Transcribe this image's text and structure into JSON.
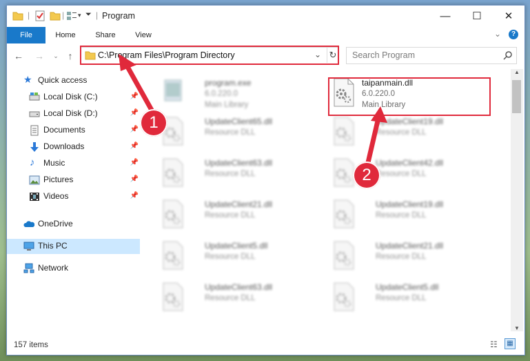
{
  "window": {
    "title": "Program",
    "caption": {
      "minimize": "—",
      "maximize": "☐",
      "close": "✕"
    }
  },
  "ribbon": {
    "tabs": [
      "File",
      "Home",
      "Share",
      "View"
    ]
  },
  "address": {
    "path": "C:\\Program Files\\Program Directory"
  },
  "search": {
    "placeholder": "Search Program"
  },
  "sidebar": {
    "items": [
      {
        "label": "Quick access",
        "icon": "star-icon",
        "pinned": false
      },
      {
        "label": "Local Disk (C:)",
        "icon": "drive-icon",
        "pinned": true
      },
      {
        "label": "Local Disk (D:)",
        "icon": "drive-icon",
        "pinned": true
      },
      {
        "label": "Documents",
        "icon": "documents-icon",
        "pinned": true
      },
      {
        "label": "Downloads",
        "icon": "download-icon",
        "pinned": true
      },
      {
        "label": "Music",
        "icon": "music-icon",
        "pinned": true
      },
      {
        "label": "Pictures",
        "icon": "pictures-icon",
        "pinned": true
      },
      {
        "label": "Videos",
        "icon": "videos-icon",
        "pinned": true
      },
      {
        "label": "OneDrive",
        "icon": "cloud-icon",
        "pinned": false
      },
      {
        "label": "This PC",
        "icon": "computer-icon",
        "pinned": false
      },
      {
        "label": "Network",
        "icon": "network-icon",
        "pinned": false
      }
    ]
  },
  "files": [
    {
      "name": "program.exe",
      "line2": "6.0.220.0",
      "line3": "Main Library",
      "highlight": false
    },
    {
      "name": "taipanmain.dll",
      "line2": "6.0.220.0",
      "line3": "Main Library",
      "highlight": true
    },
    {
      "name": "UpdateClient65.dll",
      "line2": "Resource DLL",
      "line3": "",
      "highlight": false
    },
    {
      "name": "UpdateClient19.dll",
      "line2": "Resource DLL",
      "line3": "",
      "highlight": false
    },
    {
      "name": "UpdateClient63.dll",
      "line2": "Resource DLL",
      "line3": "",
      "highlight": false
    },
    {
      "name": "UpdateClient42.dll",
      "line2": "Resource DLL",
      "line3": "",
      "highlight": false
    },
    {
      "name": "UpdateClient21.dll",
      "line2": "Resource DLL",
      "line3": "",
      "highlight": false
    },
    {
      "name": "UpdateClient19.dll",
      "line2": "Resource DLL",
      "line3": "",
      "highlight": false
    },
    {
      "name": "UpdateClient5.dll",
      "line2": "Resource DLL",
      "line3": "",
      "highlight": false
    },
    {
      "name": "UpdateClient21.dll",
      "line2": "Resource DLL",
      "line3": "",
      "highlight": false
    },
    {
      "name": "UpdateClient63.dll",
      "line2": "Resource DLL",
      "line3": "",
      "highlight": false
    },
    {
      "name": "UpdateClient5.dll",
      "line2": "Resource DLL",
      "line3": "",
      "highlight": false
    }
  ],
  "status": {
    "count": "157 items"
  },
  "annotations": {
    "step1": "1",
    "step2": "2"
  },
  "colors": {
    "accent": "#1979ca",
    "annotation": "#e0293b",
    "selected": "#cce8ff"
  }
}
